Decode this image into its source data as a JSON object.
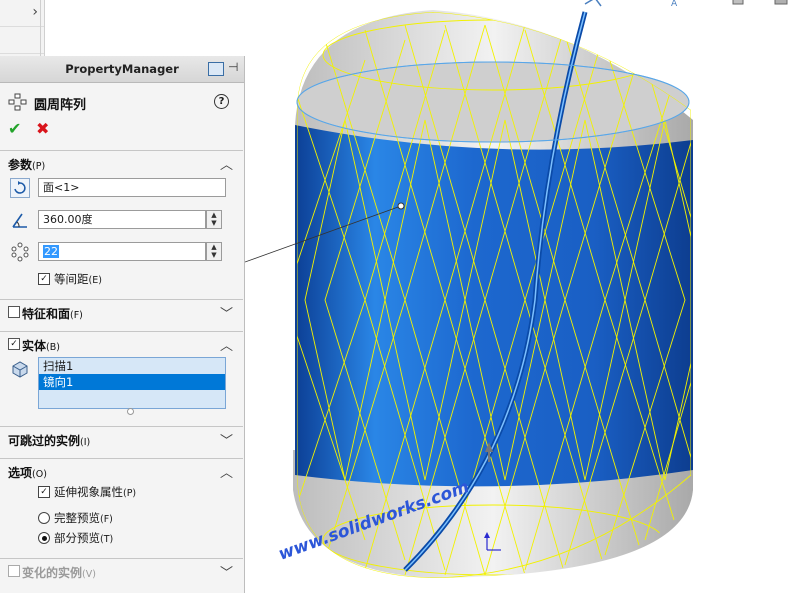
{
  "panel": {
    "title": "PropertyManager",
    "feature_name": "圆周阵列",
    "sections": {
      "params": {
        "label": "参数",
        "key": "(P)"
      },
      "features_faces": {
        "label": "特征和面",
        "key": "(F)"
      },
      "bodies": {
        "label": "实体",
        "key": "(B)"
      },
      "skip": {
        "label": "可跳过的实例",
        "key": "(I)"
      },
      "options": {
        "label": "选项",
        "key": "(O)"
      },
      "vary": {
        "label": "变化的实例",
        "key": "(V)"
      }
    },
    "fields": {
      "axis_value": "面<1>",
      "angle_value": "360.00度",
      "count_value": "22",
      "equal_spacing": "等间距",
      "equal_spacing_key": "(E)"
    },
    "bodies_list": [
      "扫描1",
      "镜向1"
    ],
    "options": {
      "extend_visual": "延伸视象属性",
      "extend_visual_key": "(P)",
      "full_preview": "完整预览",
      "full_preview_key": "(F)",
      "partial_preview": "部分预览",
      "partial_preview_key": "(T)"
    }
  },
  "viewport": {
    "watermark": "www.solidworks.com"
  },
  "colors": {
    "accent": "#0078d7",
    "wire": "#f2f200",
    "body": "#1e6fd0"
  }
}
